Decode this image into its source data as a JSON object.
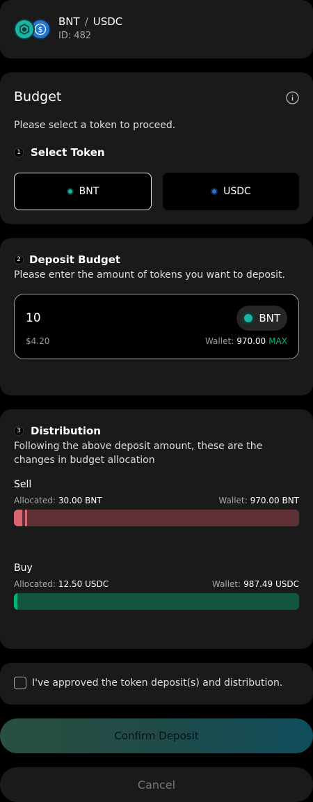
{
  "header": {
    "base_symbol": "BNT",
    "separator": "/",
    "quote_symbol": "USDC",
    "strategy_id": "ID: 482"
  },
  "budget": {
    "title": "Budget",
    "prompt": "Please select a token to proceed.",
    "step1_number": "1",
    "step1_title": "Select Token",
    "token_options": [
      "BNT",
      "USDC"
    ],
    "selected_token": "BNT"
  },
  "deposit": {
    "step_number": "2",
    "title": "Deposit Budget",
    "description": "Please enter the amount of tokens you want to deposit.",
    "amount_value": "10",
    "token_label": "BNT",
    "fiat_value": "$4.20",
    "wallet_label": "Wallet:",
    "wallet_value": "970.00",
    "max_label": "MAX"
  },
  "distribution": {
    "step_number": "3",
    "title": "Distribution",
    "description": "Following the above deposit amount, these are the changes in budget allocation",
    "sell": {
      "label": "Sell",
      "allocated_label": "Allocated:",
      "allocated_value": "30.00 BNT",
      "wallet_label": "Wallet:",
      "wallet_value": "970.00 BNT",
      "allocated_fraction": 0.03
    },
    "buy": {
      "label": "Buy",
      "allocated_label": "Allocated:",
      "allocated_value": "12.50 USDC",
      "wallet_label": "Wallet:",
      "wallet_value": "987.49 USDC",
      "allocated_fraction": 0.013
    }
  },
  "approval": {
    "text": "I've approved the token deposit(s) and distribution.",
    "checked": false
  },
  "actions": {
    "confirm_label": "Confirm Deposit",
    "cancel_label": "Cancel"
  },
  "colors": {
    "card": "#1a1a1a",
    "sell_bar": "#5e3036",
    "sell_accent": "#d86371",
    "buy_bar": "#10573d",
    "buy_accent": "#00b578",
    "max_text": "#00b578",
    "bnt_token": "#1ab3a4",
    "usdc_token": "#2775ca"
  }
}
